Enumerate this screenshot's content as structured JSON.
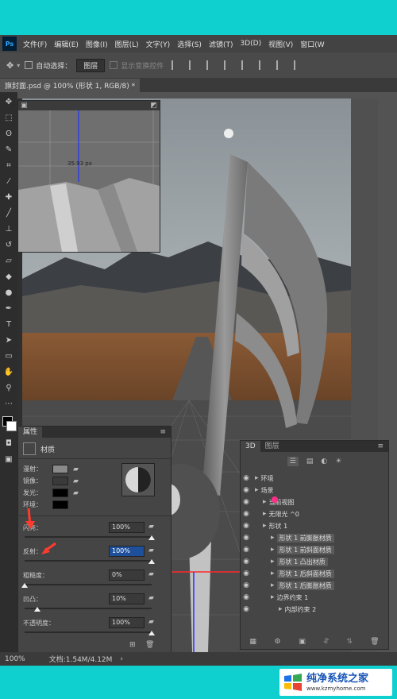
{
  "app": {
    "logo": "Ps",
    "menu": [
      "文件(F)",
      "编辑(E)",
      "图像(I)",
      "图层(L)",
      "文字(Y)",
      "选择(S)",
      "滤镜(T)",
      "3D(D)",
      "视图(V)",
      "窗口(W"
    ]
  },
  "options_bar": {
    "auto_select_label": "自动选择：",
    "auto_select_value": "图层",
    "show_transform_label": "显示变换控件"
  },
  "document": {
    "tab_title": "旗封面.psd @ 100% (形状 1, RGB/8) *",
    "ruler_readout": "35.93 px"
  },
  "status_bar": {
    "zoom": "100%",
    "doc_info": "文档:1.54M/4.12M"
  },
  "properties_panel": {
    "tab": "属性",
    "section": "材质",
    "swatches": [
      {
        "label": "漫射：",
        "color": "#8a8a8a"
      },
      {
        "label": "镜像：",
        "color": "#3a3a3a"
      },
      {
        "label": "发光：",
        "color": "#000000"
      },
      {
        "label": "环境：",
        "color": "#000000"
      }
    ],
    "sliders": [
      {
        "label": "闪亮：",
        "value": "100%",
        "level": 1.0
      },
      {
        "label": "反射：",
        "value": "100%",
        "level": 1.0,
        "active": true
      },
      {
        "label": "粗糙度：",
        "value": "0%",
        "level": 0.0
      },
      {
        "label": "凹凸：",
        "value": "10%",
        "level": 0.1
      },
      {
        "label": "不透明度：",
        "value": "100%",
        "level": 1.0
      }
    ]
  },
  "layers_3d_panel": {
    "tabs": [
      "3D",
      "图层"
    ],
    "items": [
      {
        "text": "环境",
        "indent": 0
      },
      {
        "text": "场景",
        "indent": 0
      },
      {
        "text": "当前视图",
        "indent": 1
      },
      {
        "text": "无限光 ^0",
        "indent": 1
      },
      {
        "text": "形状 1",
        "indent": 1
      },
      {
        "text": "形状 1 前膨胀材质",
        "indent": 2,
        "hl": true
      },
      {
        "text": "形状 1 前斜面材质",
        "indent": 2,
        "hl": true
      },
      {
        "text": "形状 1 凸出材质",
        "indent": 2,
        "hl": true
      },
      {
        "text": "形状 1 后斜面材质",
        "indent": 2,
        "hl": true
      },
      {
        "text": "形状 1 后膨胀材质",
        "indent": 2,
        "hl": true
      },
      {
        "text": "边界约束 1",
        "indent": 2
      },
      {
        "text": "内部约束 2",
        "indent": 3
      }
    ]
  },
  "watermark": {
    "text": "纯净系统之家",
    "url": "www.kzmyhome.com"
  },
  "colors": {
    "teal": "#0fd0cf",
    "ps_bg": "#535353",
    "red_annotation": "#ff3b30"
  }
}
